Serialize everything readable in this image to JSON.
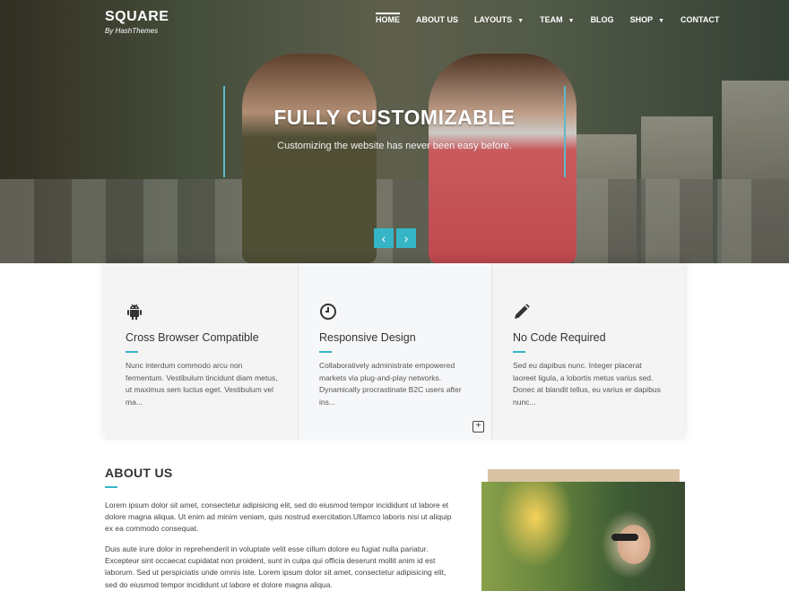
{
  "brand": {
    "name": "SQUARE",
    "tagline": "By HashThemes"
  },
  "nav": {
    "items": [
      {
        "label": "HOME",
        "active": true,
        "dropdown": false
      },
      {
        "label": "ABOUT US",
        "active": false,
        "dropdown": false
      },
      {
        "label": "LAYOUTS",
        "active": false,
        "dropdown": true
      },
      {
        "label": "TEAM",
        "active": false,
        "dropdown": true
      },
      {
        "label": "BLOG",
        "active": false,
        "dropdown": false
      },
      {
        "label": "SHOP",
        "active": false,
        "dropdown": true
      },
      {
        "label": "CONTACT",
        "active": false,
        "dropdown": false
      }
    ]
  },
  "hero": {
    "title": "FULLY CUSTOMIZABLE",
    "subtitle": "Customizing the website has never been easy before.",
    "prev_icon": "chevron-left-icon",
    "next_icon": "chevron-right-icon"
  },
  "features": [
    {
      "icon": "android-icon",
      "title": "Cross Browser Compatible",
      "text": "Nunc interdum commodo arcu non fermentum. Vestibulum tincidunt diam metus, ut maximus sem luctus eget. Vestibulum vel ma..."
    },
    {
      "icon": "clock-icon",
      "title": "Responsive Design",
      "text": "Collaboratively administrate empowered markets via plug-and-play networks. Dynamically procrastinate B2C users after ins..."
    },
    {
      "icon": "pencil-icon",
      "title": "No Code Required",
      "text": "Sed eu dapibus nunc. Integer placerat laoreet ligula, a lobortis metus varius sed. Donec at blandit tellus, eu varius er dapibus nunc..."
    }
  ],
  "about": {
    "title": "ABOUT US",
    "paragraphs": [
      "Lorem ipsum dolor sit amet, consectetur adipisicing elit, sed do eiusmod tempor incididunt ut labore et dolore magna aliqua. Ut enim ad minim veniam, quis nostrud exercitation.Ullamco laboris nisi ut aliquip ex ea commodo consequat.",
      "Duis aute irure dolor in reprehenderit in voluptate velit esse cillum dolore eu fugiat nulla pariatur. Excepteur sint occaecat cupidatat non proident, sunt in culpa qui officia deserunt mollit anim id est laborum. Sed ut perspiciatis unde omnis iste. Lorem ipsum dolor sit amet, consectetur adipisicing elit, sed do eiusmod tempor incididunt ut labore et dolore magna aliqua."
    ]
  },
  "colors": {
    "accent": "#35b5c5",
    "text": "#333333"
  }
}
